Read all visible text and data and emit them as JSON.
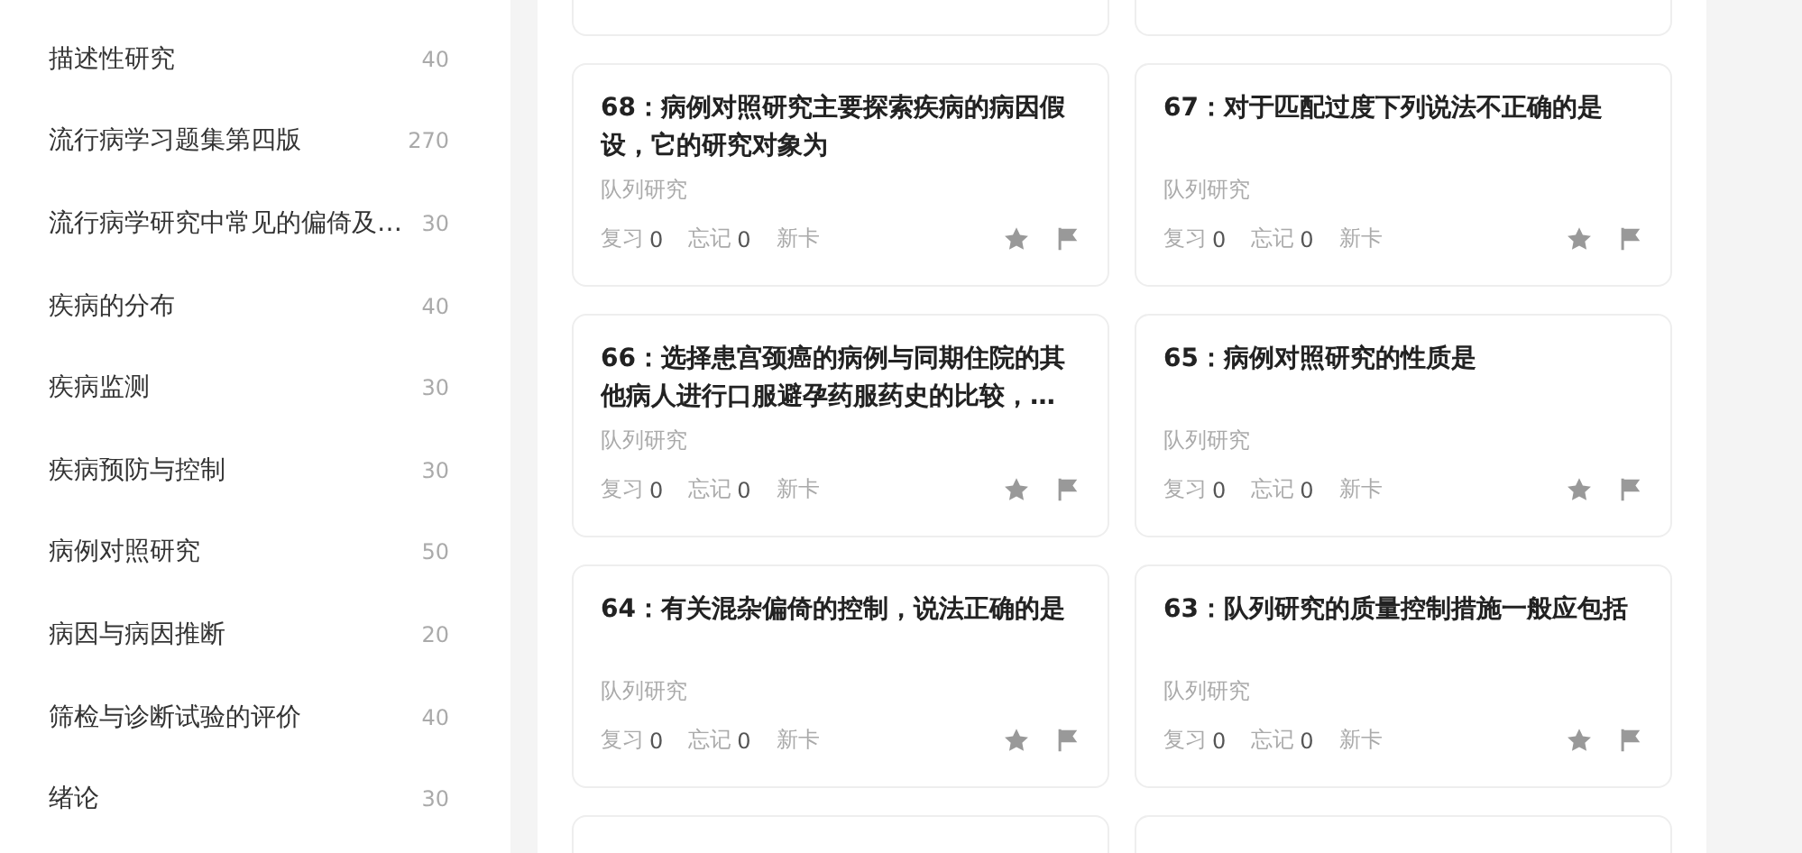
{
  "sidebar": {
    "items": [
      {
        "label": "描述性研究",
        "count": "40"
      },
      {
        "label": "流行病学习题集第四版",
        "count": "270"
      },
      {
        "label": "流行病学研究中常见的偏倚及…",
        "count": "30"
      },
      {
        "label": "疾病的分布",
        "count": "40"
      },
      {
        "label": "疾病监测",
        "count": "30"
      },
      {
        "label": "疾病预防与控制",
        "count": "30"
      },
      {
        "label": "病例对照研究",
        "count": "50"
      },
      {
        "label": "病因与病因推断",
        "count": "20"
      },
      {
        "label": "筛检与诊断试验的评价",
        "count": "40"
      },
      {
        "label": "绪论",
        "count": "30"
      }
    ]
  },
  "cards": [
    {
      "title": "68：病例对照研究主要探索疾病的病因假设，它的研究对象为",
      "tag": "队列研究",
      "review_label": "复习",
      "review_count": "0",
      "forget_label": "忘记",
      "forget_count": "0",
      "status": "新卡"
    },
    {
      "title": "67：对于匹配过度下列说法不正确的是",
      "tag": "队列研究",
      "review_label": "复习",
      "review_count": "0",
      "forget_label": "忘记",
      "forget_count": "0",
      "status": "新卡"
    },
    {
      "title": "66：选择患宫颈癌的病例与同期住院的其他病人进行口服避孕药服药史的比较，…",
      "tag": "队列研究",
      "review_label": "复习",
      "review_count": "0",
      "forget_label": "忘记",
      "forget_count": "0",
      "status": "新卡"
    },
    {
      "title": "65：病例对照研究的性质是",
      "tag": "队列研究",
      "review_label": "复习",
      "review_count": "0",
      "forget_label": "忘记",
      "forget_count": "0",
      "status": "新卡"
    },
    {
      "title": "64：有关混杂偏倚的控制，说法正确的是",
      "tag": "队列研究",
      "review_label": "复习",
      "review_count": "0",
      "forget_label": "忘记",
      "forget_count": "0",
      "status": "新卡"
    },
    {
      "title": "63：队列研究的质量控制措施一般应包括",
      "tag": "队列研究",
      "review_label": "复习",
      "review_count": "0",
      "forget_label": "忘记",
      "forget_count": "0",
      "status": "新卡"
    }
  ]
}
